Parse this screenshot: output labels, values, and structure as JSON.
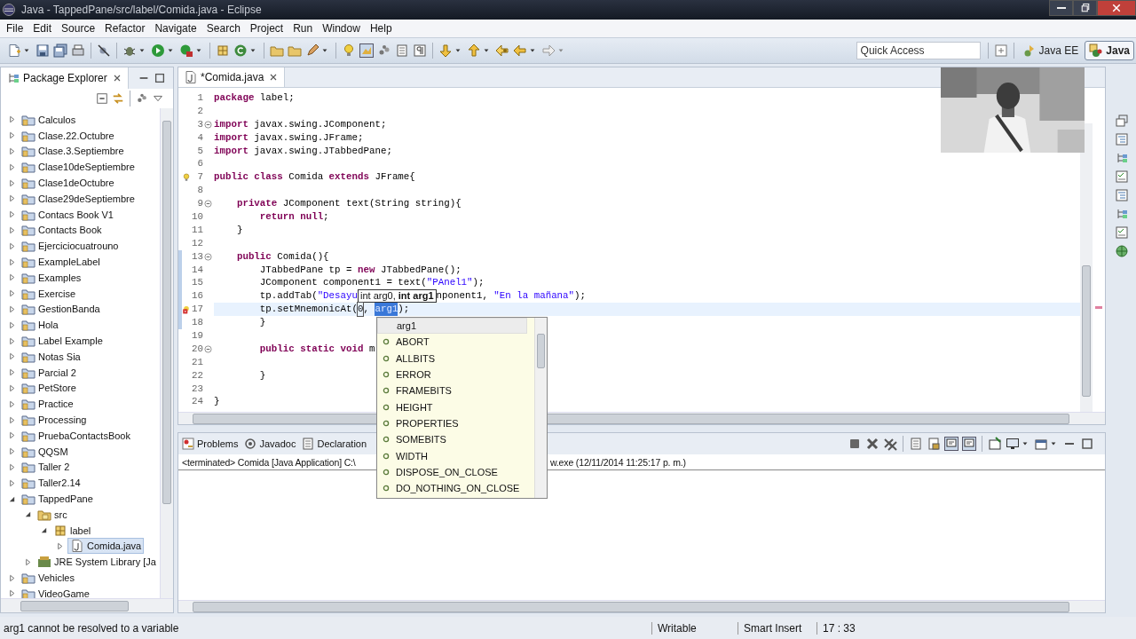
{
  "window": {
    "title": "Java - TappedPane/src/label/Comida.java - Eclipse"
  },
  "menu": [
    "File",
    "Edit",
    "Source",
    "Refactor",
    "Navigate",
    "Search",
    "Project",
    "Run",
    "Window",
    "Help"
  ],
  "quick_access": {
    "placeholder": "Quick Access"
  },
  "perspectives": [
    {
      "label": "Java EE",
      "selected": false
    },
    {
      "label": "Java",
      "selected": true
    }
  ],
  "package_explorer": {
    "title": "Package Explorer",
    "items": [
      {
        "label": "Calculos",
        "kind": "project",
        "expanded": false,
        "selected": false
      },
      {
        "label": "Clase.22.Octubre",
        "kind": "project",
        "expanded": false,
        "selected": false
      },
      {
        "label": "Clase.3.Septiembre",
        "kind": "project",
        "expanded": false,
        "selected": false
      },
      {
        "label": "Clase10deSeptiembre",
        "kind": "project",
        "expanded": false,
        "selected": false
      },
      {
        "label": "Clase1deOctubre",
        "kind": "project",
        "expanded": false,
        "selected": false
      },
      {
        "label": "Clase29deSeptiembre",
        "kind": "project",
        "expanded": false,
        "selected": false
      },
      {
        "label": "Contacs Book V1",
        "kind": "project",
        "expanded": false,
        "selected": false
      },
      {
        "label": "Contacts Book",
        "kind": "project",
        "expanded": false,
        "selected": false
      },
      {
        "label": "Ejerciciocuatrouno",
        "kind": "project",
        "expanded": false,
        "selected": false
      },
      {
        "label": "ExampleLabel",
        "kind": "project",
        "expanded": false,
        "selected": false
      },
      {
        "label": "Examples",
        "kind": "project",
        "expanded": false,
        "selected": false
      },
      {
        "label": "Exercise",
        "kind": "project",
        "expanded": false,
        "selected": false
      },
      {
        "label": "GestionBanda",
        "kind": "project",
        "expanded": false,
        "selected": false
      },
      {
        "label": "Hola",
        "kind": "project",
        "expanded": false,
        "selected": false
      },
      {
        "label": "Label Example",
        "kind": "project",
        "expanded": false,
        "selected": false
      },
      {
        "label": "Notas Sia",
        "kind": "project",
        "expanded": false,
        "selected": false
      },
      {
        "label": "Parcial 2",
        "kind": "project",
        "expanded": false,
        "selected": false
      },
      {
        "label": "PetStore",
        "kind": "project",
        "expanded": false,
        "selected": false
      },
      {
        "label": "Practice",
        "kind": "project",
        "expanded": false,
        "selected": false
      },
      {
        "label": "Processing",
        "kind": "project",
        "expanded": false,
        "selected": false
      },
      {
        "label": "PruebaContactsBook",
        "kind": "project",
        "expanded": false,
        "selected": false
      },
      {
        "label": "QQSM",
        "kind": "project",
        "expanded": false,
        "selected": false
      },
      {
        "label": "Taller 2",
        "kind": "project",
        "expanded": false,
        "selected": false
      },
      {
        "label": "Taller2.14",
        "kind": "project",
        "expanded": false,
        "selected": false
      },
      {
        "label": "TappedPane",
        "kind": "project",
        "expanded": true,
        "selected": false,
        "children": [
          {
            "label": "src",
            "kind": "folder",
            "expanded": true,
            "selected": false,
            "children": [
              {
                "label": "label",
                "kind": "package",
                "expanded": true,
                "selected": false,
                "children": [
                  {
                    "label": "Comida.java",
                    "kind": "file",
                    "expanded": false,
                    "selected": true
                  }
                ]
              }
            ]
          },
          {
            "label": "JRE System Library [Ja",
            "kind": "library",
            "expanded": false,
            "selected": false
          }
        ]
      },
      {
        "label": "Vehicles",
        "kind": "project",
        "expanded": false,
        "selected": false
      },
      {
        "label": "VideoGame",
        "kind": "project",
        "expanded": false,
        "selected": false
      }
    ]
  },
  "editor": {
    "tabs": [
      {
        "label": "*Comida.java",
        "selected": true
      }
    ],
    "lines": [
      {
        "num": "1",
        "current": false,
        "changed": false,
        "code": [
          {
            "text": "package",
            "kind": "kw"
          },
          {
            "text": " label;",
            "kind": "plain"
          }
        ]
      },
      {
        "num": "2",
        "current": false,
        "changed": false
      },
      {
        "num": "3",
        "current": false,
        "changed": false,
        "folded": false,
        "code": [
          {
            "text": "import",
            "kind": "kw"
          },
          {
            "text": " javax.swing.JComponent;",
            "kind": "plain"
          }
        ]
      },
      {
        "num": "4",
        "current": false,
        "changed": false,
        "code": [
          {
            "text": "import",
            "kind": "kw"
          },
          {
            "text": " javax.swing.JFrame;",
            "kind": "plain"
          }
        ]
      },
      {
        "num": "5",
        "current": false,
        "changed": false,
        "code": [
          {
            "text": "import",
            "kind": "kw"
          },
          {
            "text": " javax.swing.JTabbedPane;",
            "kind": "plain"
          }
        ]
      },
      {
        "num": "6",
        "current": false,
        "changed": false
      },
      {
        "num": "7",
        "current": false,
        "changed": false,
        "kind": "warning",
        "code": [
          {
            "text": "public class",
            "kind": "kw"
          },
          {
            "text": " Comida ",
            "kind": "plain"
          },
          {
            "text": "extends",
            "kind": "kw"
          },
          {
            "text": " JFrame{",
            "kind": "plain"
          }
        ]
      },
      {
        "num": "8",
        "current": false,
        "changed": false
      },
      {
        "num": "9",
        "current": false,
        "changed": false,
        "folded": false,
        "code": [
          {
            "text": "    private",
            "kind": "kw"
          },
          {
            "text": " JComponent text(String string){",
            "kind": "plain"
          }
        ]
      },
      {
        "num": "10",
        "current": false,
        "changed": false,
        "code": [
          {
            "text": "        return null",
            "kind": "kw"
          },
          {
            "text": ";",
            "kind": "plain"
          }
        ]
      },
      {
        "num": "11",
        "current": false,
        "changed": false,
        "code": [
          {
            "text": "    }",
            "kind": "plain"
          }
        ]
      },
      {
        "num": "12",
        "current": false,
        "changed": false
      },
      {
        "num": "13",
        "current": false,
        "changed": true,
        "folded": false,
        "code": [
          {
            "text": "    public",
            "kind": "kw"
          },
          {
            "text": " Comida(){",
            "kind": "plain"
          }
        ]
      },
      {
        "num": "14",
        "current": false,
        "changed": true,
        "code": [
          {
            "text": "        JTabbedPane tp = ",
            "kind": "plain"
          },
          {
            "text": "new",
            "kind": "kw"
          },
          {
            "text": " JTabbedPane();",
            "kind": "plain"
          }
        ]
      },
      {
        "num": "15",
        "current": false,
        "changed": true,
        "code": [
          {
            "text": "        JComponent component1 = text(",
            "kind": "plain"
          },
          {
            "text": "\"PAnel1\"",
            "kind": "str"
          },
          {
            "text": ");",
            "kind": "plain"
          }
        ]
      },
      {
        "num": "16",
        "current": false,
        "changed": true,
        "code": [
          {
            "text": "        tp.addTab(",
            "kind": "plain"
          },
          {
            "text": "\"Desayu",
            "kind": "str"
          },
          {
            "text": "int arg0, **int arg1**",
            "kind": "hint"
          },
          {
            "text": "nponent1, ",
            "kind": "plain"
          },
          {
            "text": "\"En la mañana\"",
            "kind": "str"
          },
          {
            "text": ");",
            "kind": "plain"
          }
        ]
      },
      {
        "num": "17",
        "current": true,
        "changed": true,
        "kind": "error",
        "code": [
          {
            "text": "        tp.setMnemonicAt(",
            "kind": "plain"
          },
          {
            "text": "0",
            "kind": "linked"
          },
          {
            "text": ", ",
            "kind": "plain"
          },
          {
            "text": "arg1",
            "kind": "sel"
          },
          {
            "text": ");",
            "kind": "plain"
          }
        ]
      },
      {
        "num": "18",
        "current": false,
        "changed": true,
        "code": [
          {
            "text": "        }",
            "kind": "plain"
          }
        ]
      },
      {
        "num": "19",
        "current": false,
        "changed": false
      },
      {
        "num": "20",
        "current": false,
        "changed": false,
        "folded": false,
        "code": [
          {
            "text": "        public static void",
            "kind": "kw"
          },
          {
            "text": " m",
            "kind": "plain"
          }
        ]
      },
      {
        "num": "21",
        "current": false,
        "changed": false
      },
      {
        "num": "22",
        "current": false,
        "changed": false,
        "code": [
          {
            "text": "        }",
            "kind": "plain"
          }
        ]
      },
      {
        "num": "23",
        "current": false,
        "changed": false
      },
      {
        "num": "24",
        "current": false,
        "changed": false,
        "code": [
          {
            "text": "}",
            "kind": "plain"
          }
        ]
      }
    ]
  },
  "completion": {
    "items": [
      {
        "label": "arg1",
        "kind": "variable",
        "selected": true
      },
      {
        "label": "ABORT",
        "kind": "field",
        "selected": false
      },
      {
        "label": "ALLBITS",
        "kind": "field",
        "selected": false
      },
      {
        "label": "ERROR",
        "kind": "field",
        "selected": false
      },
      {
        "label": "FRAMEBITS",
        "kind": "field",
        "selected": false
      },
      {
        "label": "HEIGHT",
        "kind": "field",
        "selected": false
      },
      {
        "label": "PROPERTIES",
        "kind": "field",
        "selected": false
      },
      {
        "label": "SOMEBITS",
        "kind": "field",
        "selected": false
      },
      {
        "label": "WIDTH",
        "kind": "field",
        "selected": false
      },
      {
        "label": "DISPOSE_ON_CLOSE",
        "kind": "field",
        "selected": false
      },
      {
        "label": "DO_NOTHING_ON_CLOSE",
        "kind": "field",
        "selected": false
      }
    ]
  },
  "bottom_panel": {
    "tabs": [
      {
        "label": "Problems",
        "kind": "problems",
        "selected": false
      },
      {
        "label": "Javadoc",
        "kind": "javadoc",
        "selected": false
      },
      {
        "label": "Declaration",
        "kind": "declaration",
        "selected": false
      }
    ],
    "console_line": {
      "start": "<terminated> Comida [Java Application] C:\\",
      "end": "w.exe (12/11/2014 11:25:17 p. m.)"
    }
  },
  "status_bar": {
    "message": "arg1 cannot be resolved to a variable",
    "mode": "Writable",
    "insert": "Smart Insert",
    "position": "17 : 33"
  }
}
